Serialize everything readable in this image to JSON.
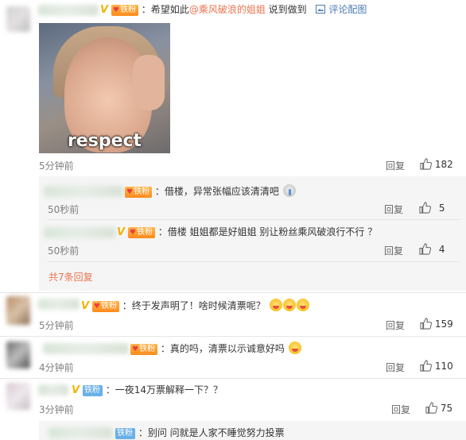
{
  "comment1": {
    "text_prefix": "：希望如此",
    "mention": "@乘风破浪的姐姐",
    "text_suffix": " 说到做到",
    "image_comment_link": "评论配图",
    "image_caption": "respect",
    "time": "5分钟前",
    "reply_label": "回复",
    "likes": "182",
    "badge": "铁粉"
  },
  "replies": [
    {
      "text": "：借楼，异常张幅应该清清吧",
      "time": "50秒前",
      "reply_label": "回复",
      "likes": "5",
      "badge": "铁粉"
    },
    {
      "text": "：借楼 姐姐都是好姐姐 别让粉丝乘风破浪行不行 ？",
      "time": "50秒前",
      "reply_label": "回复",
      "likes": "4",
      "badge": "铁粉"
    }
  ],
  "more_replies": "共7条回复",
  "comment2": {
    "text": "：终于发声明了！啥时候清票呢？",
    "time": "5分钟前",
    "reply_label": "回复",
    "likes": "159",
    "badge": "铁粉"
  },
  "comment3": {
    "text": "：真的吗，清票以示诚意好吗",
    "time": "4分钟前",
    "reply_label": "回复",
    "likes": "110",
    "badge": "铁粉"
  },
  "comment4": {
    "text": "：一夜14万票解释一下？？",
    "time": "3分钟前",
    "reply_label": "回复",
    "likes": "75",
    "badge": "铁粉"
  },
  "comment5": {
    "text": "：别问 问就是人家不睡觉努力投票",
    "badge": "铁粉"
  },
  "icons": [
    "image-icon",
    "thumbs-up-icon",
    "v-verified-icon",
    "emoji-icon"
  ],
  "colors": {
    "link": "#eb7350",
    "badge_orange": "#ff9a2e",
    "badge_blue": "#6ab0e8",
    "sub_bg": "#f5f5f5"
  }
}
